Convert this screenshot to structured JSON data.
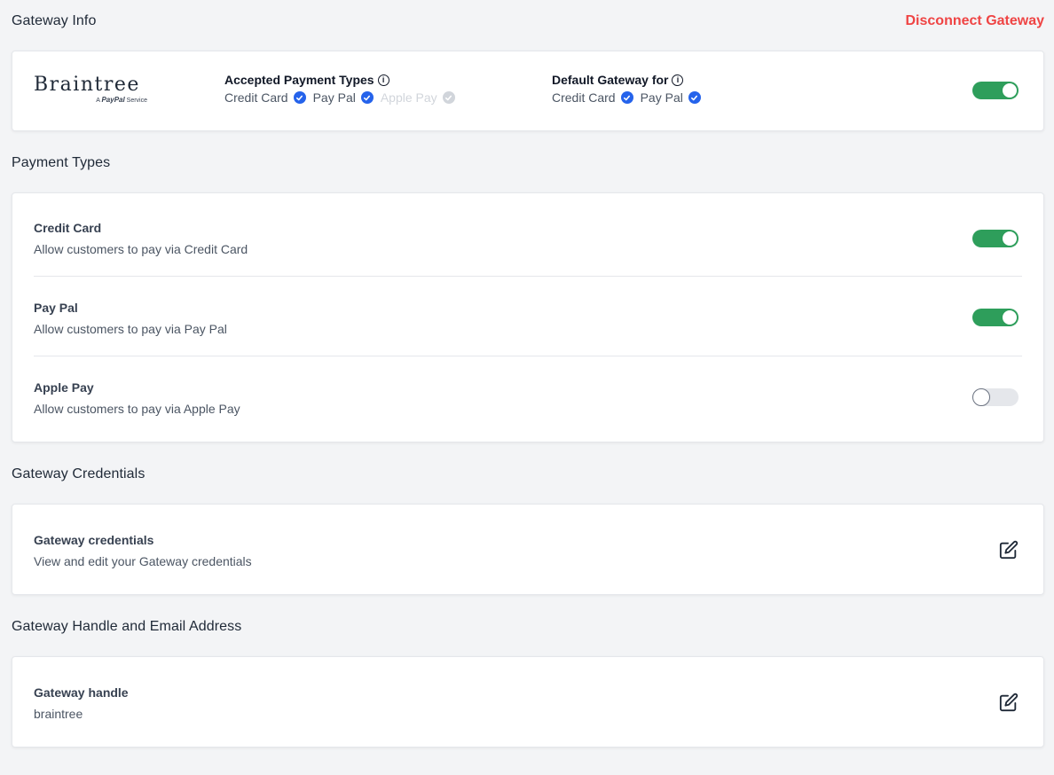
{
  "gateway_info": {
    "title": "Gateway Info",
    "disconnect_label": "Disconnect Gateway",
    "logo": {
      "name": "Braintree",
      "tagline_prefix": "A",
      "tagline_brand": "PayPal",
      "tagline_suffix": "Service"
    },
    "accepted": {
      "label": "Accepted Payment Types",
      "items": [
        {
          "label": "Credit Card",
          "enabled": true
        },
        {
          "label": "Pay Pal",
          "enabled": true
        },
        {
          "label": "Apple Pay",
          "enabled": false
        }
      ]
    },
    "default_for": {
      "label": "Default Gateway for",
      "items": [
        {
          "label": "Credit Card",
          "enabled": true
        },
        {
          "label": "Pay Pal",
          "enabled": true
        }
      ]
    },
    "gateway_enabled": true
  },
  "payment_types": {
    "title": "Payment Types",
    "items": [
      {
        "title": "Credit Card",
        "desc": "Allow customers to pay via Credit Card",
        "enabled": true
      },
      {
        "title": "Pay Pal",
        "desc": "Allow customers to pay via Pay Pal",
        "enabled": true
      },
      {
        "title": "Apple Pay",
        "desc": "Allow customers to pay via Apple Pay",
        "enabled": false
      }
    ]
  },
  "credentials": {
    "title": "Gateway Credentials",
    "item_title": "Gateway credentials",
    "item_desc": "View and edit your Gateway credentials"
  },
  "handle": {
    "title": "Gateway Handle and Email Address",
    "item_title": "Gateway handle",
    "item_value": "braintree"
  },
  "colors": {
    "accent_danger": "#ef4444",
    "toggle_on": "#2e9e5b",
    "check_blue": "#2563eb"
  }
}
